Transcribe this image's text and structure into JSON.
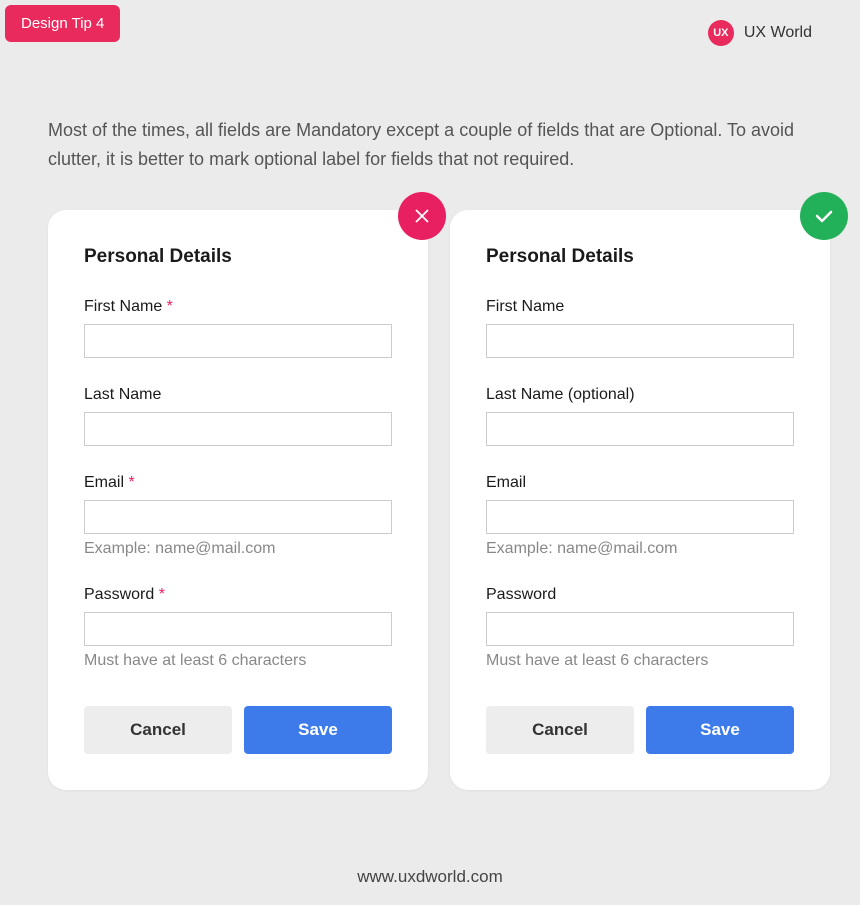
{
  "badge": "Design Tip 4",
  "brand": {
    "icon_text": "UX",
    "name": "UX World"
  },
  "description": "Most of the times, all fields are Mandatory except a couple of fields that are Optional. To avoid clutter, it is better to mark optional label for fields that not required.",
  "card_bad": {
    "title": "Personal Details",
    "fields": {
      "first_name": {
        "label": "First Name ",
        "required_mark": "*"
      },
      "last_name": {
        "label": "Last Name"
      },
      "email": {
        "label": "Email ",
        "required_mark": "*",
        "hint": "Example: name@mail.com"
      },
      "password": {
        "label": "Password ",
        "required_mark": "*",
        "hint": "Must have at least 6 characters"
      }
    },
    "buttons": {
      "cancel": "Cancel",
      "save": "Save"
    }
  },
  "card_good": {
    "title": "Personal Details",
    "fields": {
      "first_name": {
        "label": "First Name"
      },
      "last_name": {
        "label": "Last Name (optional)"
      },
      "email": {
        "label": "Email",
        "hint": "Example: name@mail.com"
      },
      "password": {
        "label": "Password",
        "hint": "Must have at least 6 characters"
      }
    },
    "buttons": {
      "cancel": "Cancel",
      "save": "Save"
    }
  },
  "footer": "www.uxdworld.com"
}
